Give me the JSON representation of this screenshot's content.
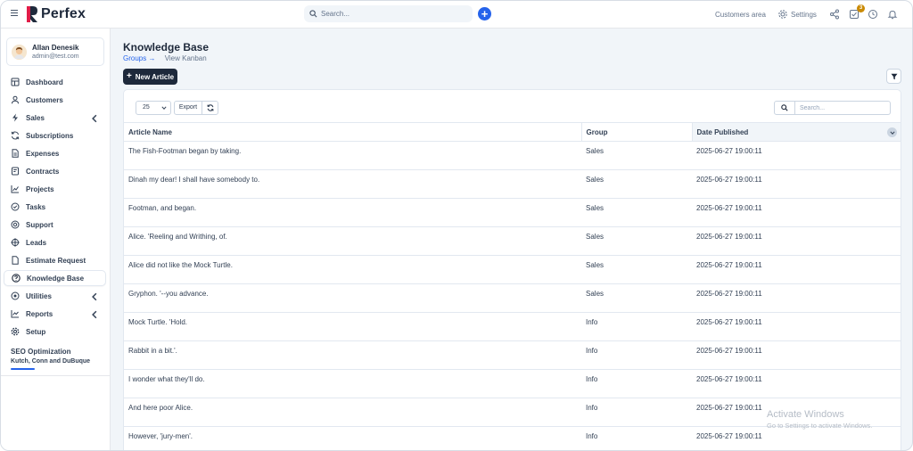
{
  "app": {
    "name": "Perfex",
    "brand_color": "#1e293b",
    "accent_color": "#2563eb"
  },
  "topbar": {
    "search_placeholder": "Search...",
    "customers_area": "Customers area",
    "settings": "Settings",
    "notification_count": "3"
  },
  "user": {
    "name": "Allan Denesik",
    "email": "admin@test.com"
  },
  "sidebar": {
    "items": [
      {
        "label": "Dashboard",
        "icon": "dashboard-icon"
      },
      {
        "label": "Customers",
        "icon": "user-icon"
      },
      {
        "label": "Sales",
        "icon": "bolt-icon",
        "expandable": true
      },
      {
        "label": "Subscriptions",
        "icon": "refresh-icon"
      },
      {
        "label": "Expenses",
        "icon": "document-icon"
      },
      {
        "label": "Contracts",
        "icon": "contract-icon"
      },
      {
        "label": "Projects",
        "icon": "chart-icon"
      },
      {
        "label": "Tasks",
        "icon": "check-circle-icon"
      },
      {
        "label": "Support",
        "icon": "lifebuoy-icon"
      },
      {
        "label": "Leads",
        "icon": "target-icon"
      },
      {
        "label": "Estimate Request",
        "icon": "file-icon"
      },
      {
        "label": "Knowledge Base",
        "icon": "question-icon",
        "active": true
      },
      {
        "label": "Utilities",
        "icon": "cog-circle-icon",
        "expandable": true
      },
      {
        "label": "Reports",
        "icon": "line-chart-icon",
        "expandable": true
      },
      {
        "label": "Setup",
        "icon": "gear-icon"
      }
    ],
    "project": {
      "title": "SEO Optimization",
      "client": "Kutch, Conn and DuBuque"
    }
  },
  "page": {
    "title": "Knowledge Base",
    "breadcrumb_link": "Groups →",
    "breadcrumb_view": "View Kanban",
    "new_button": "New Article"
  },
  "table": {
    "page_size": "25",
    "export_label": "Export",
    "search_placeholder": "Search...",
    "columns": [
      "Article Name",
      "Group",
      "Date Published"
    ],
    "rows": [
      {
        "name": "The Fish-Footman began by taking.",
        "group": "Sales",
        "date": "2025-06-27 19:00:11"
      },
      {
        "name": "Dinah my dear! I shall have somebody to.",
        "group": "Sales",
        "date": "2025-06-27 19:00:11"
      },
      {
        "name": "Footman, and began.",
        "group": "Sales",
        "date": "2025-06-27 19:00:11"
      },
      {
        "name": "Alice. 'Reeling and Writhing, of.",
        "group": "Sales",
        "date": "2025-06-27 19:00:11"
      },
      {
        "name": "Alice did not like the Mock Turtle.",
        "group": "Sales",
        "date": "2025-06-27 19:00:11"
      },
      {
        "name": "Gryphon. '--you advance.",
        "group": "Sales",
        "date": "2025-06-27 19:00:11"
      },
      {
        "name": "Mock Turtle. 'Hold.",
        "group": "Info",
        "date": "2025-06-27 19:00:11"
      },
      {
        "name": "Rabbit in a bit.'.",
        "group": "Info",
        "date": "2025-06-27 19:00:11"
      },
      {
        "name": "I wonder what they'll do.",
        "group": "Info",
        "date": "2025-06-27 19:00:11"
      },
      {
        "name": "And here poor Alice.",
        "group": "Info",
        "date": "2025-06-27 19:00:11"
      },
      {
        "name": "However, 'jury-men'.",
        "group": "Info",
        "date": "2025-06-27 19:00:11"
      }
    ]
  },
  "watermark": {
    "title": "Activate Windows",
    "subtitle": "Go to Settings to activate Windows."
  }
}
